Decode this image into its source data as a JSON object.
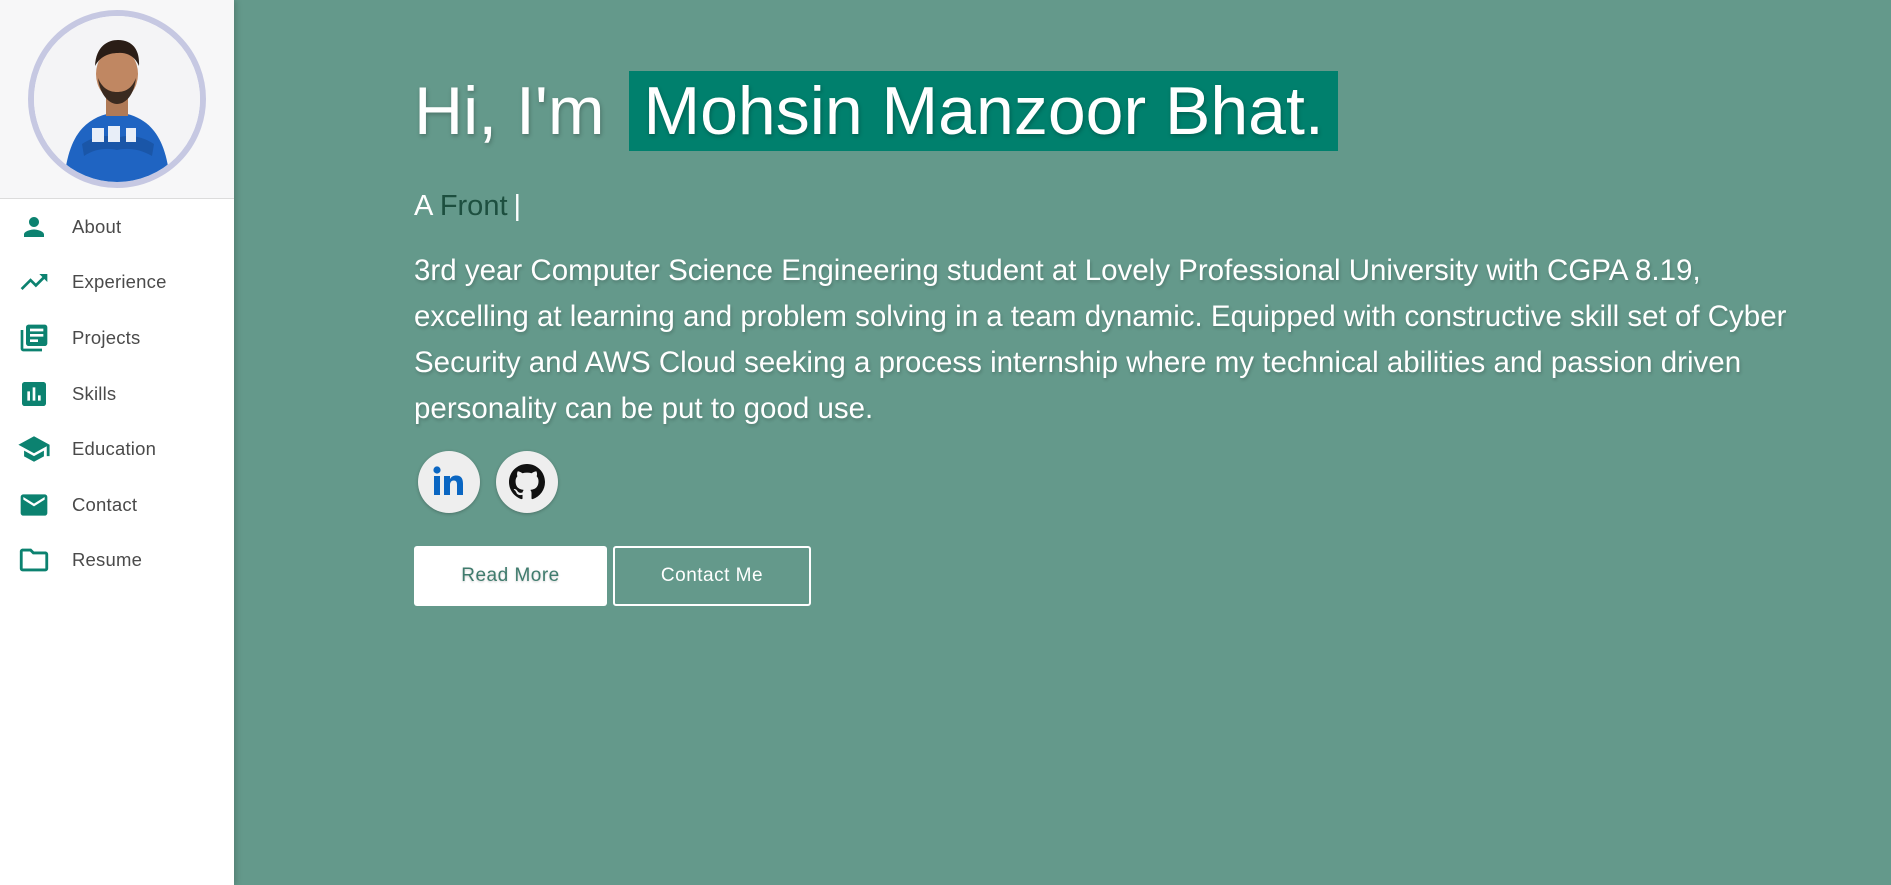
{
  "colors": {
    "background": "#64998b",
    "accent": "#00806d",
    "typed_word": "#1d4f3f",
    "sidebar_icon": "#0c8270",
    "avatar_ring": "#c6c8e2"
  },
  "sidebar": {
    "avatar_alt": "Profile photo",
    "items": [
      {
        "label": "About",
        "icon": "person-icon"
      },
      {
        "label": "Experience",
        "icon": "trending-up-icon"
      },
      {
        "label": "Projects",
        "icon": "library-books-icon"
      },
      {
        "label": "Skills",
        "icon": "bar-chart-icon"
      },
      {
        "label": "Education",
        "icon": "school-icon"
      },
      {
        "label": "Contact",
        "icon": "mail-icon"
      },
      {
        "label": "Resume",
        "icon": "folder-icon"
      }
    ]
  },
  "hero": {
    "greeting": "Hi, I'm",
    "name": "Mohsin Manzoor Bhat.",
    "typed_prefix": "A",
    "typed_word": "Front",
    "typed_caret": "|",
    "bio": "3rd year Computer Science Engineering student at Lovely Professional University with CGPA 8.19, excelling at learning and problem solving in a team dynamic. Equipped with constructive skill set of Cyber Security and AWS Cloud seeking a process internship where my technical abilities and passion driven personality can be put to good use.",
    "socials": [
      {
        "icon": "linkedin-icon"
      },
      {
        "icon": "github-icon"
      }
    ],
    "read_more_label": "Read More",
    "contact_label": "Contact Me"
  }
}
